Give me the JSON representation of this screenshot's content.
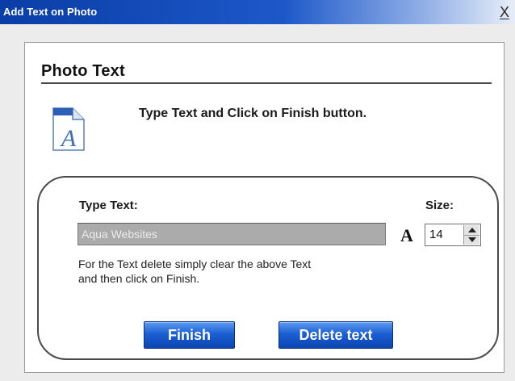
{
  "window": {
    "title": "Add Text on Photo",
    "close_label": "X"
  },
  "header": {
    "title": "Photo Text",
    "instruction": "Type Text and Click on Finish button.",
    "icon": "font-document-icon"
  },
  "form": {
    "type_text_label": "Type Text:",
    "text_value": "Aqua Websites",
    "font_icon_glyph": "A",
    "size_label": "Size:",
    "size_value": "14",
    "help_line1": "For the Text delete simply clear the above Text",
    "help_line2": "and then click on Finish."
  },
  "buttons": {
    "finish_label": "Finish",
    "delete_label": "Delete text"
  },
  "colors": {
    "titlebar": "#1d58c9",
    "button": "#1c5fd3",
    "input_bg": "#ababab"
  }
}
